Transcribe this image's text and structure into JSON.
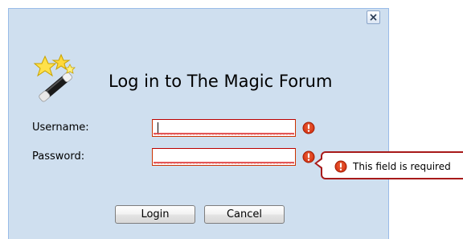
{
  "dialog": {
    "title": "Log in to The Magic Forum",
    "icons": {
      "logo": "magic-wand-stars-icon",
      "close": "close-icon",
      "error": "error-icon"
    }
  },
  "form": {
    "username": {
      "label": "Username:",
      "value": "",
      "invalid": true
    },
    "password": {
      "label": "Password:",
      "value": "",
      "invalid": true
    }
  },
  "tooltip": {
    "message": "This field is required"
  },
  "buttons": {
    "login": "Login",
    "cancel": "Cancel"
  },
  "colors": {
    "dialog_background": "#cfdfef",
    "dialog_border": "#99bbe8",
    "error_red": "#cc2200",
    "tooltip_border": "#a81a1a"
  }
}
